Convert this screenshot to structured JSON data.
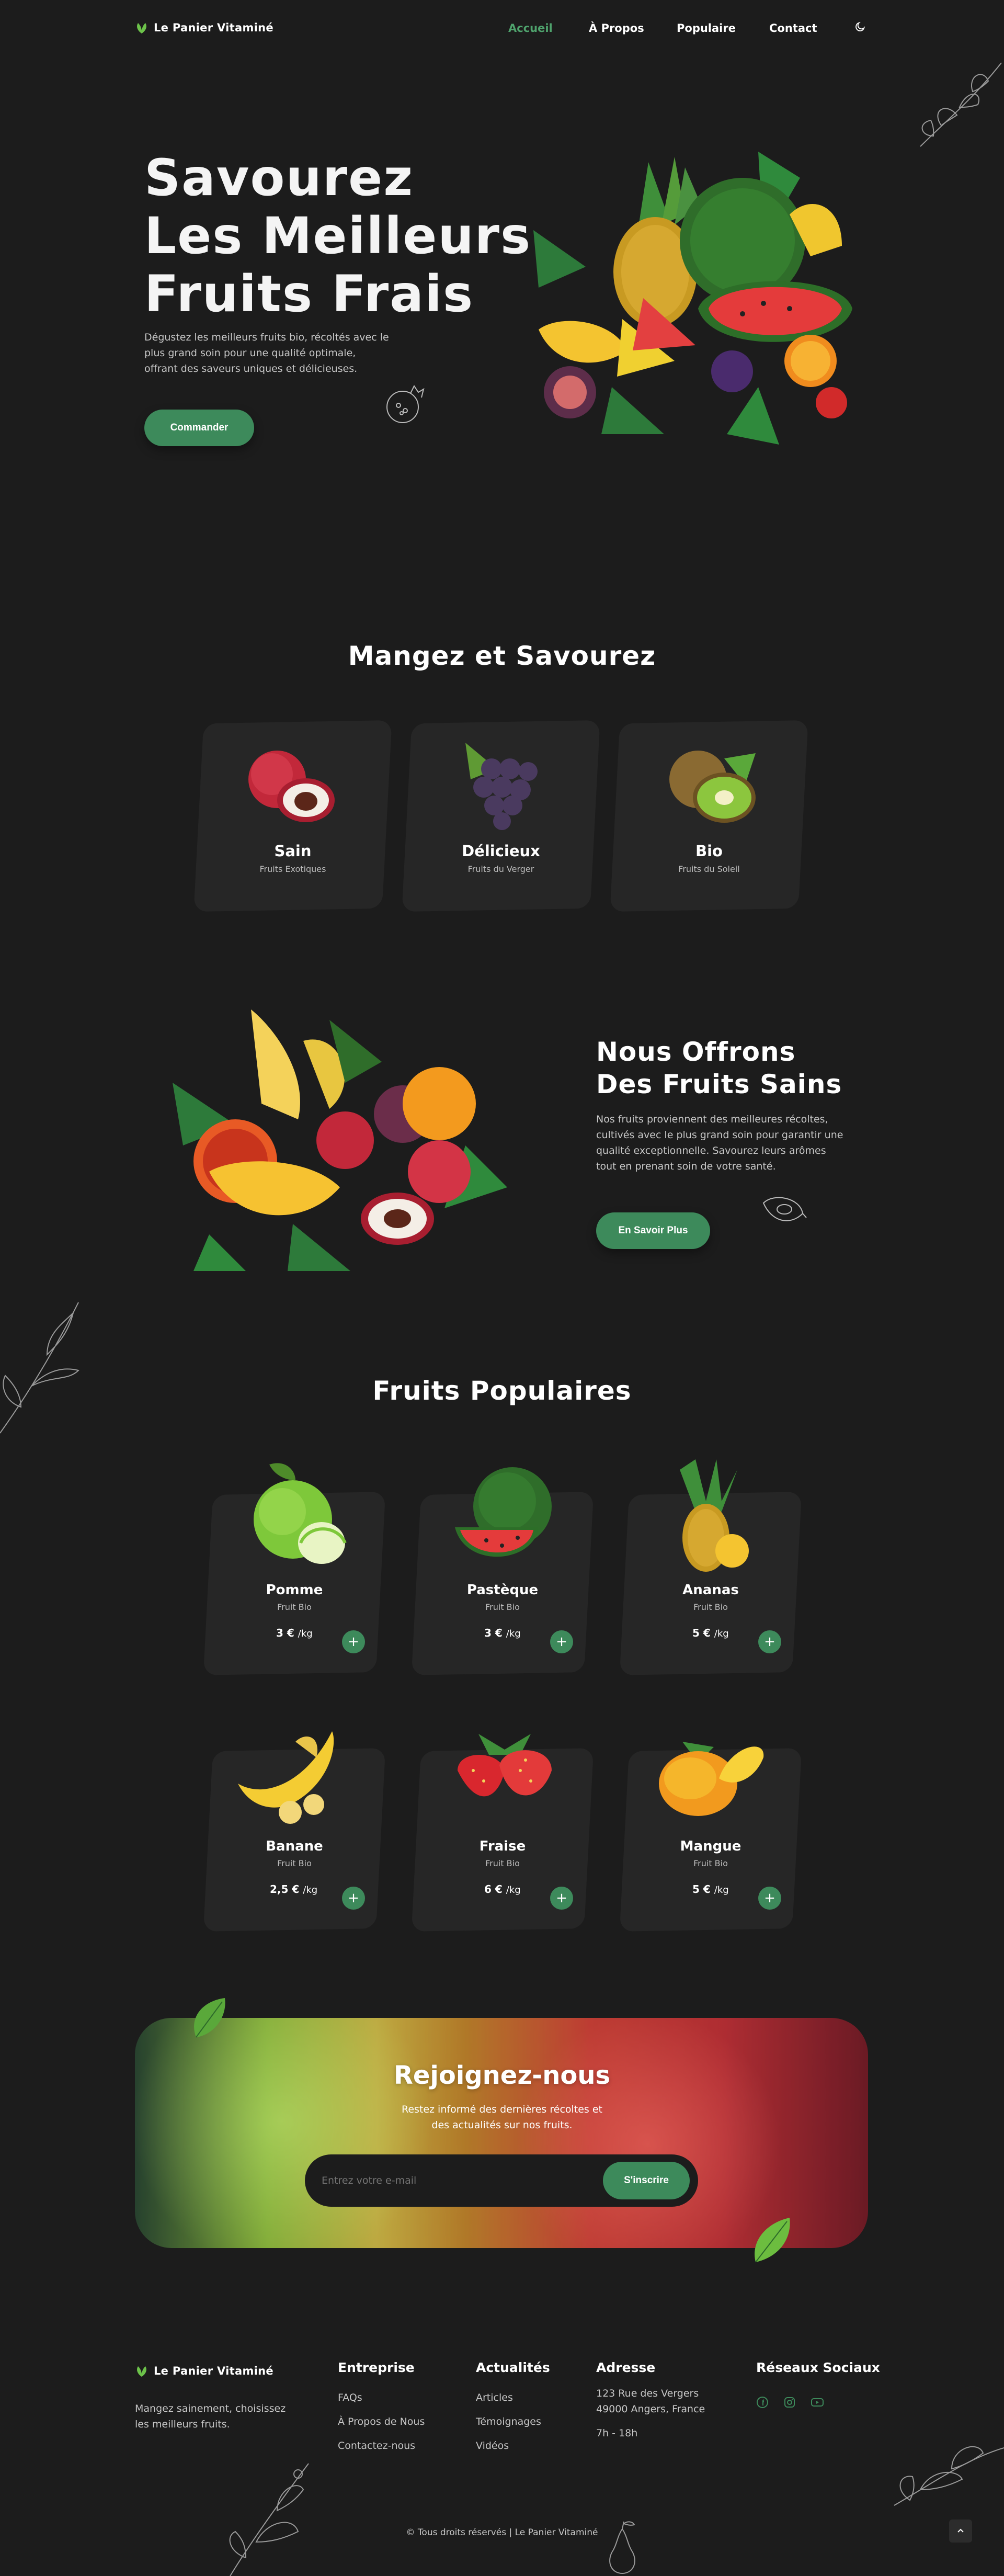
{
  "header": {
    "logo": "Le Panier Vitaminé",
    "nav": [
      "Accueil",
      "À Propos",
      "Populaire",
      "Contact"
    ]
  },
  "hero": {
    "title_lines": [
      "Savourez",
      "Les Meilleurs",
      "Fruits Frais"
    ],
    "text_lines": [
      "Dégustez les meilleurs fruits bio, récoltés avec le",
      "plus grand soin pour une qualité optimale,",
      "offrant des saveurs uniques et délicieuses."
    ],
    "button": "Commander"
  },
  "categories": {
    "title": "Mangez et Savourez",
    "items": [
      {
        "name": "Sain",
        "sub": "Fruits Exotiques"
      },
      {
        "name": "Délicieux",
        "sub": "Fruits du Verger"
      },
      {
        "name": "Bio",
        "sub": "Fruits du Soleil"
      }
    ]
  },
  "about": {
    "title_lines": [
      "Nous Offrons",
      "Des Fruits Sains"
    ],
    "text_lines": [
      "Nos fruits proviennent des meilleures récoltes,",
      "cultivés avec le plus grand soin pour garantir une",
      "qualité exceptionnelle. Savourez leurs arômes",
      "tout en prenant soin de votre santé."
    ],
    "button": "En Savoir Plus"
  },
  "popular": {
    "title": "Fruits Populaires",
    "items": [
      {
        "name": "Pomme",
        "sub": "Fruit Bio",
        "price": "3 €",
        "unit": "/kg"
      },
      {
        "name": "Pastèque",
        "sub": "Fruit Bio",
        "price": "3 €",
        "unit": "/kg"
      },
      {
        "name": "Ananas",
        "sub": "Fruit Bio",
        "price": "5 €",
        "unit": "/kg"
      },
      {
        "name": "Banane",
        "sub": "Fruit Bio",
        "price": "2,5 €",
        "unit": "/kg"
      },
      {
        "name": "Fraise",
        "sub": "Fruit Bio",
        "price": "6 €",
        "unit": "/kg"
      },
      {
        "name": "Mangue",
        "sub": "Fruit Bio",
        "price": "5 €",
        "unit": "/kg"
      }
    ]
  },
  "newsletter": {
    "title": "Rejoignez-nous",
    "text_lines": [
      "Restez informé des dernières récoltes et",
      "des actualités sur nos fruits."
    ],
    "placeholder": "Entrez votre e-mail",
    "button": "S'inscrire"
  },
  "footer": {
    "logo": "Le Panier Vitaminé",
    "tagline_lines": [
      "Mangez sainement, choisissez",
      "les meilleurs fruits."
    ],
    "columns": [
      {
        "title": "Entreprise",
        "links": [
          "FAQs",
          "À Propos de Nous",
          "Contactez-nous"
        ]
      },
      {
        "title": "Actualités",
        "links": [
          "Articles",
          "Témoignages",
          "Vidéos"
        ]
      },
      {
        "title": "Adresse",
        "links": [
          "123 Rue des Vergers",
          "49000 Angers, France",
          "7h - 18h"
        ]
      }
    ],
    "social_title": "Réseaux Sociaux",
    "copyright": "© Tous droits réservés | Le Panier Vitaminé"
  },
  "colors": {
    "accent": "#3d8a5b",
    "accent_light": "#4fa36d",
    "background": "#1c1c1c",
    "card": "#262626"
  }
}
